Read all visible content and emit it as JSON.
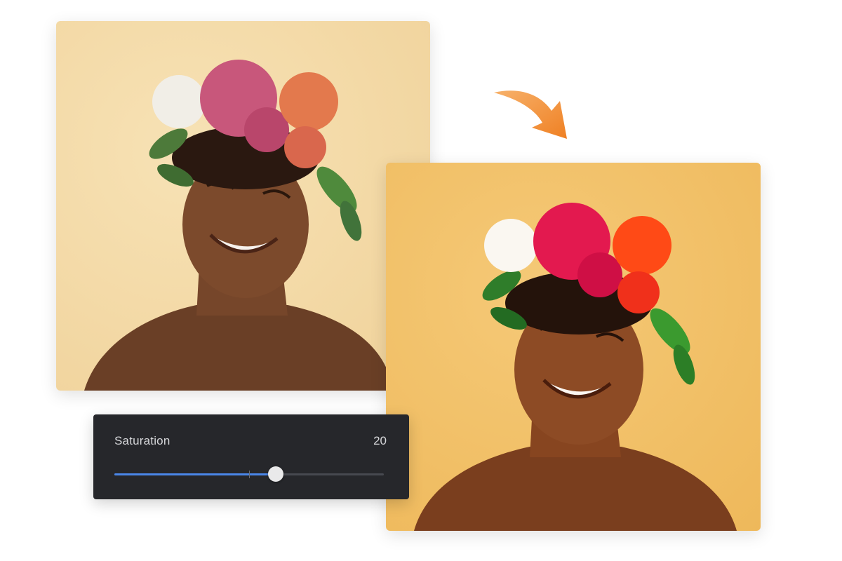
{
  "images": {
    "before": {
      "alt": "",
      "background": "#f5dba6"
    },
    "after": {
      "alt": "",
      "background": "#f2c36a"
    }
  },
  "arrow": {
    "icon": "curved-arrow-icon",
    "color": "#f08b2b"
  },
  "adjustment_panel": {
    "label": "Saturation",
    "value": "20",
    "slider": {
      "fraction": 0.6,
      "center_fraction": 0.5,
      "fill_color": "#4a86e8"
    }
  }
}
